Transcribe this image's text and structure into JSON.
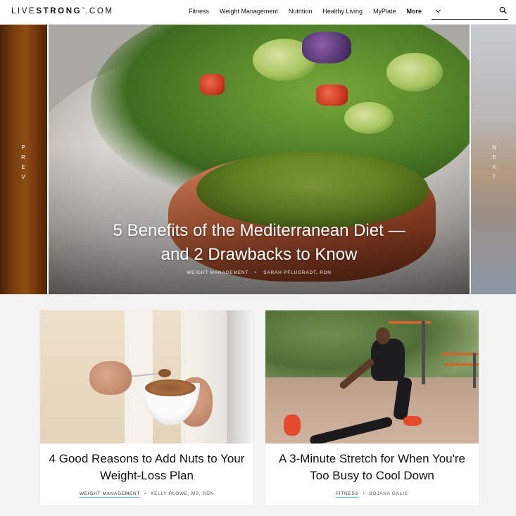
{
  "header": {
    "logo": {
      "part1": "LIVE",
      "part2": "STRONG",
      "tm": "™",
      "part3": ".COM"
    },
    "nav": [
      {
        "label": "Fitness"
      },
      {
        "label": "Weight Management"
      },
      {
        "label": "Nutrition"
      },
      {
        "label": "Healthy Living"
      },
      {
        "label": "MyPlate"
      }
    ],
    "more_label": "More",
    "search": {
      "placeholder": "",
      "value": ""
    }
  },
  "hero": {
    "prev_label": "P\nR\nE\nV",
    "next_label": "N\nE\nX\nT",
    "title": "5 Benefits of the Mediterranean Diet — and 2 Drawbacks to Know",
    "category": "WEIGHT MANAGEMENT",
    "author": "SARAH PFLUGRADT, RDN",
    "separator": "•"
  },
  "cards": [
    {
      "title": "4 Good Reasons to Add Nuts to Your Weight-Loss Plan",
      "category": "WEIGHT MANAGEMENT",
      "author": "KELLY PLOWE, MS, RDN",
      "separator": "•"
    },
    {
      "title": "A 3-Minute Stretch for When You're Too Busy to Cool Down",
      "category": "FITNESS",
      "author": "BOJANA GALIC",
      "separator": "•"
    }
  ],
  "colors": {
    "accent_underline": "#5ec2c7",
    "text": "#111111",
    "page_bg": "#f4f4f4"
  }
}
